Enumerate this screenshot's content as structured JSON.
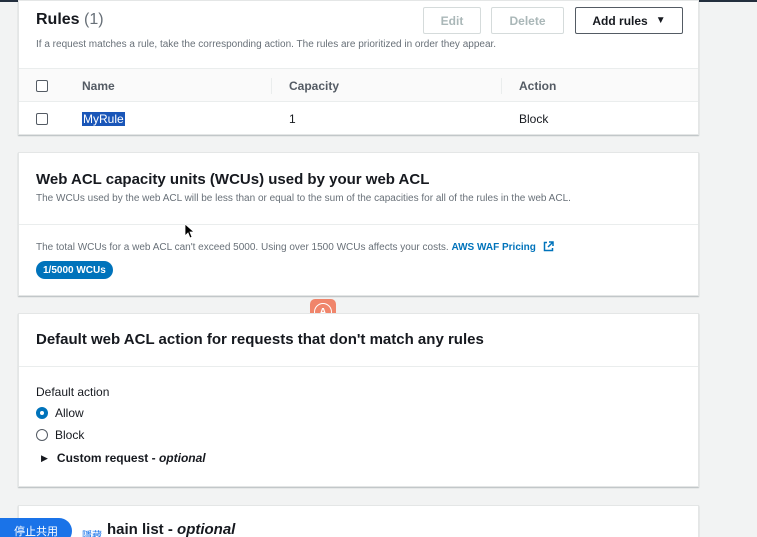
{
  "rules": {
    "title": "Rules",
    "count": "(1)",
    "description": "If a request matches a rule, take the corresponding action. The rules are prioritized in order they appear.",
    "buttons": {
      "edit": "Edit",
      "delete": "Delete",
      "add_rules": "Add rules"
    },
    "columns": [
      "Name",
      "Capacity",
      "Action"
    ],
    "rows": [
      {
        "name": "MyRule",
        "capacity": "1",
        "action": "Block"
      }
    ]
  },
  "wcu": {
    "title": "Web ACL capacity units (WCUs) used by your web ACL",
    "description": "The WCUs used by the web ACL will be less than or equal to the sum of the capacities for all of the rules in the web ACL.",
    "note": "The total WCUs for a web ACL can't exceed 5000. Using over 1500 WCUs affects your costs.",
    "link": "AWS WAF Pricing",
    "badge": "1/5000 WCUs"
  },
  "default_action": {
    "title": "Default web ACL action for requests that don't match any rules",
    "field_label": "Default action",
    "options": [
      {
        "label": "Allow",
        "checked": true
      },
      {
        "label": "Block",
        "checked": false
      }
    ],
    "expander_label": "Custom request",
    "expander_optional": "optional"
  },
  "domain_list": {
    "title": "hain list",
    "optional": "optional"
  },
  "overlay": {
    "stop_share": "停止共用",
    "hide": "隱藏",
    "badge_glyph": "A"
  },
  "colors": {
    "accent": "#0073bb",
    "primary_text": "#16191f",
    "secondary_text": "#687078",
    "selection": "#1a56b8"
  }
}
